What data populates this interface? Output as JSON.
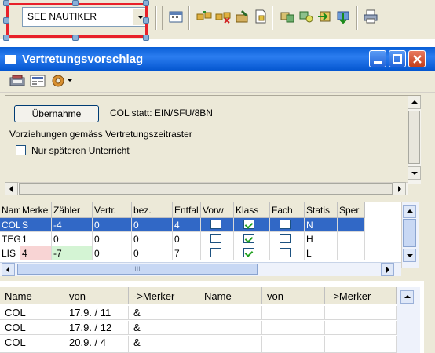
{
  "toolbar": {
    "combo_value": "SEE NAUTIKER",
    "icons": [
      "calendar-icon",
      "move-icon",
      "move-delete-icon",
      "edit-icon",
      "document-icon",
      "cut-icon",
      "swap-icon",
      "export-icon",
      "import-icon",
      "print-icon"
    ]
  },
  "window": {
    "title": "Vertretungsvorschlag",
    "accent_color": "#0a5fd6",
    "selection_color": "#e8212a"
  },
  "panel": {
    "uebernahme_label": "Übernahme",
    "suggestion_text": "COL statt: EIN/SFU/8BN",
    "vorziehungen_text": "Vorziehungen gemäss Vertretungszeitraster",
    "nur_spaeteren_label": "Nur späteren Unterricht",
    "nur_spaeteren_checked": false
  },
  "grid1": {
    "columns": [
      "Name",
      "Merke",
      "Zähler",
      "Vertr.",
      "bez.",
      "Entfal",
      "Vorw",
      "Klass",
      "Fach",
      "Statis",
      "Sper"
    ],
    "rows": [
      {
        "name": "COL",
        "merker": "S",
        "zaehler": "-4",
        "vertr": "0",
        "bez": "0",
        "entfall": "4",
        "vorw": false,
        "klass": true,
        "fach": false,
        "status": "N",
        "selected": true
      },
      {
        "name": "TEG",
        "merker": "1",
        "zaehler": "0",
        "vertr": "0",
        "bez": "0",
        "entfall": "0",
        "vorw": false,
        "klass": true,
        "fach": false,
        "status": "H",
        "selected": false
      },
      {
        "name": "LIS",
        "merker": "4",
        "zaehler": "-7",
        "vertr": "0",
        "bez": "0",
        "entfall": "7",
        "vorw": false,
        "klass": true,
        "fach": false,
        "status": "L",
        "selected": false
      }
    ],
    "scroll_label": "III"
  },
  "grid2": {
    "columns": [
      "Name",
      "von",
      "->Merker",
      "Name",
      "von",
      "->Merker"
    ],
    "rows": [
      {
        "name": "COL",
        "von": "17.9. / 11",
        "merker": "&"
      },
      {
        "name": "COL",
        "von": "17.9. / 12",
        "merker": "&"
      },
      {
        "name": "COL",
        "von": "20.9. / 4",
        "merker": "&"
      }
    ]
  }
}
